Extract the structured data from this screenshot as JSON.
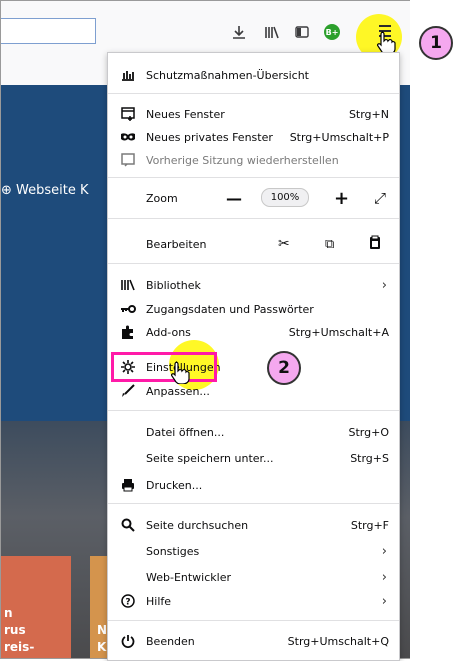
{
  "page": {
    "link_text": "Webseite K",
    "tile1_lines": [
      "n",
      "rus",
      "reis-"
    ],
    "tile2_lines": [
      "N",
      "K"
    ]
  },
  "callouts": {
    "first": "1",
    "second": "2"
  },
  "menu": {
    "protection_overview": "Schutzmaßnahmen-Übersicht",
    "new_window": {
      "label": "Neues Fenster",
      "shortcut": "Strg+N"
    },
    "new_private_window": {
      "label": "Neues privates Fenster",
      "shortcut": "Strg+Umschalt+P"
    },
    "restore_session": "Vorherige Sitzung wiederherstellen",
    "zoom": {
      "label": "Zoom",
      "minus": "—",
      "value": "100%",
      "plus": "+",
      "fullscreen": "⤢"
    },
    "edit": {
      "label": "Bearbeiten"
    },
    "library": "Bibliothek",
    "logins": "Zugangsdaten und Passwörter",
    "addons": {
      "label": "Add-ons",
      "shortcut": "Strg+Umschalt+A"
    },
    "settings": "Einstellungen",
    "customize": "Anpassen...",
    "open_file": {
      "label": "Datei öffnen...",
      "shortcut": "Strg+O"
    },
    "save_page": {
      "label": "Seite speichern unter...",
      "shortcut": "Strg+S"
    },
    "print": "Drucken...",
    "find": {
      "label": "Seite durchsuchen",
      "shortcut": "Strg+F"
    },
    "more": "Sonstiges",
    "webdev": "Web-Entwickler",
    "help": "Hilfe",
    "quit": {
      "label": "Beenden",
      "shortcut": "Strg+Umschalt+Q"
    }
  },
  "colors": {
    "highlight": "#fff700",
    "callout_bg": "#f5a8ef",
    "box": "#ff1aa8",
    "page_blue": "#1e4b7b"
  }
}
